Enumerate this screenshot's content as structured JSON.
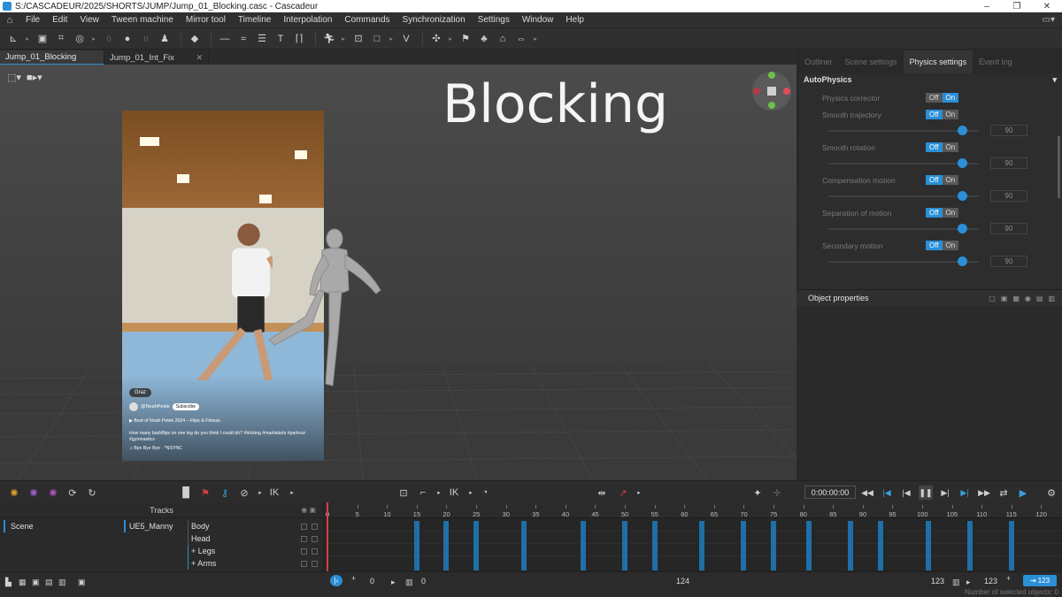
{
  "window": {
    "title": "S:/CASCADEUR/2025/SHORTS/JUMP/Jump_01_Blocking.casc - Cascadeur",
    "minimize": "–",
    "maximize": "❐",
    "close": "✕"
  },
  "menu": [
    "File",
    "Edit",
    "View",
    "Tween machine",
    "Mirror tool",
    "Timeline",
    "Interpolation",
    "Commands",
    "Synchronization",
    "Settings",
    "Window",
    "Help"
  ],
  "toolbar": {
    "num_a": "0",
    "num_b": "0"
  },
  "tabs": [
    {
      "label": "Jump_01_Blocking",
      "active": true
    },
    {
      "label": "Jump_01_Int_Fix",
      "active": false
    }
  ],
  "viewport": {
    "headline": "Blocking",
    "video": {
      "location": "Graz",
      "user": "@NoahPetek",
      "subscribe": "Subscribe",
      "playlist": "▶ Best of Noah Petek 2024 – Flips & Fitness",
      "caption": "How many backflips on one leg do you think I could do? #tricking #martialarts #parkour #gymnastics",
      "music": "♫ Bye Bye Bye · *NSYNC"
    }
  },
  "right_panel": {
    "tabs": [
      {
        "label": "Outliner",
        "active": false
      },
      {
        "label": "Scene settings",
        "active": false
      },
      {
        "label": "Physics settings",
        "active": true
      },
      {
        "label": "Event log",
        "active": false
      }
    ],
    "section": "AutoPhysics",
    "collapse_icon": "▾",
    "off_label": "Off",
    "on_label": "On",
    "properties": [
      {
        "label": "Physics corrector",
        "state": "on",
        "slider": null
      },
      {
        "label": "Smooth trajectory",
        "state": "off",
        "slider": "90"
      },
      {
        "label": "Smooth rotation",
        "state": "off",
        "slider": "90"
      },
      {
        "label": "Compensation motion",
        "state": "off",
        "slider": "90"
      },
      {
        "label": "Separation of motion",
        "state": "off",
        "slider": "90"
      },
      {
        "label": "Secondary motion",
        "state": "off",
        "slider": "90"
      }
    ],
    "object_properties": "Object properties"
  },
  "playback": {
    "timecode": "0:00:00:00"
  },
  "tracks": {
    "header": "Tracks",
    "scene": "Scene",
    "character": "UE5_Manny",
    "rows": [
      "Body",
      "Head",
      "+ Legs",
      "+ Arms"
    ]
  },
  "timeline": {
    "ticks": [
      "0",
      "5",
      "10",
      "15",
      "20",
      "25",
      "30",
      "35",
      "40",
      "45",
      "50",
      "55",
      "60",
      "65",
      "70",
      "75",
      "80",
      "85",
      "90",
      "95",
      "100",
      "105",
      "110",
      "115",
      "120"
    ],
    "keyframes": [
      15,
      20,
      25,
      33,
      43,
      50,
      55,
      63,
      70,
      75,
      81,
      88,
      93,
      101,
      108,
      115
    ]
  },
  "status": {
    "start_frame": "0",
    "range_start": "0",
    "total_frames": "124",
    "range_end": "123",
    "end_frame": "123",
    "end_pill": "123",
    "selected_objects": "Number of selected objects: 0"
  },
  "colors": {
    "accent": "#2a8fd6",
    "key": "#1f6fa8",
    "playhead": "#d84040"
  }
}
